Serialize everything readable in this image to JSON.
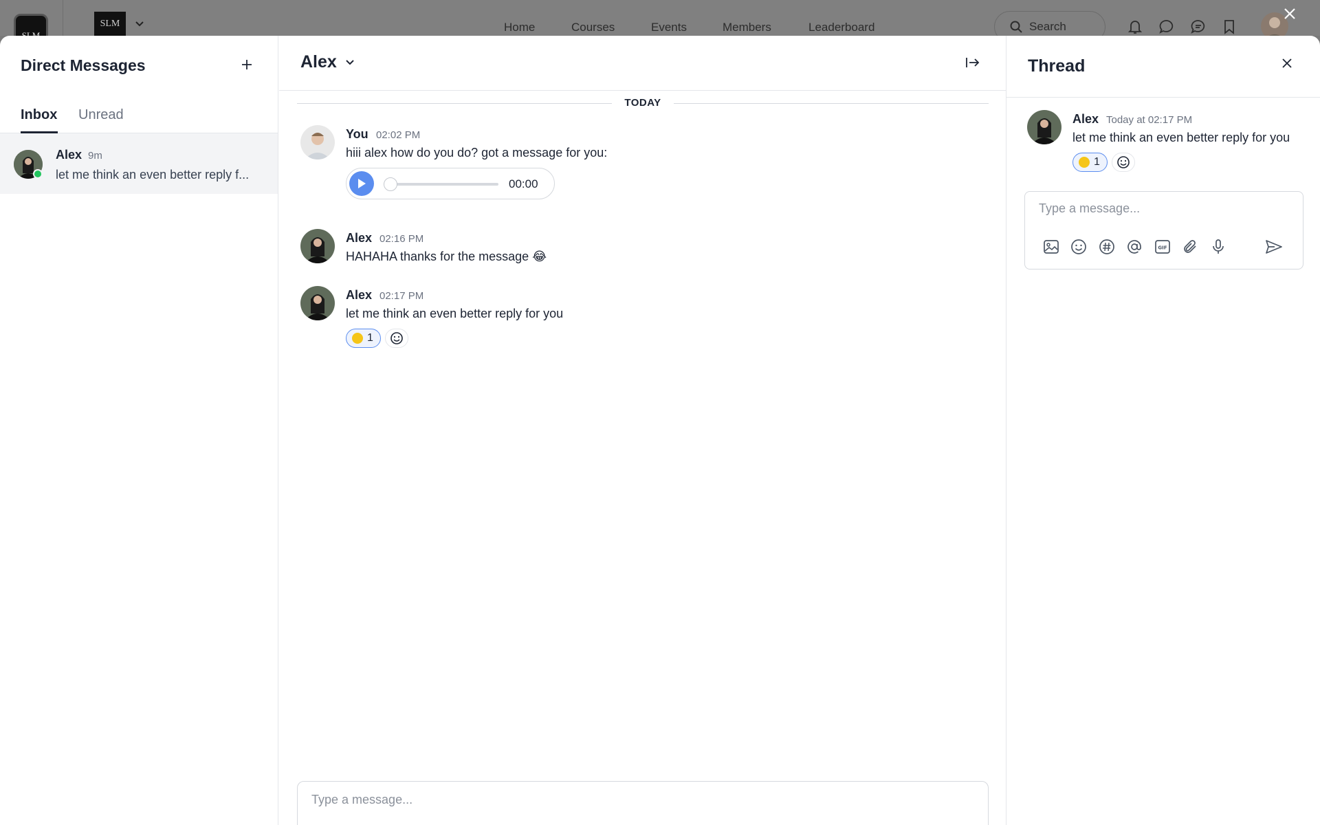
{
  "topbar": {
    "logo_text": "SLM",
    "brand_text": "SLM",
    "nav": [
      "Home",
      "Courses",
      "Events",
      "Members",
      "Leaderboard"
    ],
    "search_label": "Search"
  },
  "sidebar": {
    "title": "Direct Messages",
    "tabs": [
      "Inbox",
      "Unread"
    ],
    "conversations": [
      {
        "name": "Alex",
        "time": "9m",
        "preview": "let me think an even better reply f..."
      }
    ]
  },
  "chat": {
    "title": "Alex",
    "date_divider": "TODAY",
    "messages": [
      {
        "author": "You",
        "time": "02:02 PM",
        "text": "hiii alex how do you do? got a message for you:",
        "audio_time": "00:00"
      },
      {
        "author": "Alex",
        "time": "02:16 PM",
        "text": "HAHAHA thanks for the message 😂"
      },
      {
        "author": "Alex",
        "time": "02:17 PM",
        "text": "let me think an even better reply for you",
        "reaction_count": "1"
      }
    ],
    "composer_placeholder": "Type a message..."
  },
  "thread": {
    "title": "Thread",
    "author": "Alex",
    "time": "Today at 02:17 PM",
    "text": "let me think an even better reply for you",
    "reaction_count": "1",
    "composer_placeholder": "Type a message..."
  },
  "icons": {
    "toolbar": [
      "image-icon",
      "emoji-icon",
      "hashtag-icon",
      "mention-icon",
      "gif-icon",
      "attachment-icon",
      "microphone-icon",
      "send-icon"
    ]
  },
  "colors": {
    "accent": "#5b8def",
    "online": "#22c55e",
    "text": "#1d2433"
  }
}
